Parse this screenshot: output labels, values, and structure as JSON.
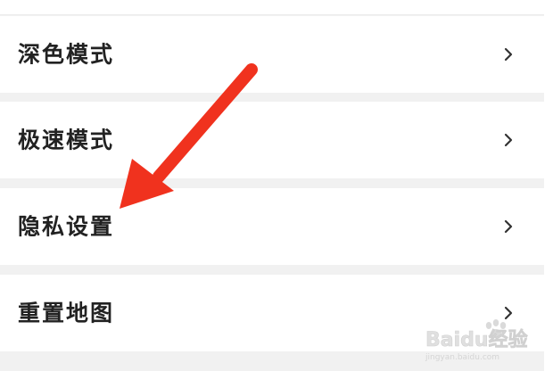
{
  "settings": {
    "items": [
      {
        "label": "深色模式",
        "icon": "chevron-right-icon"
      },
      {
        "label": "极速模式",
        "icon": "chevron-right-icon"
      },
      {
        "label": "隐私设置",
        "icon": "chevron-right-icon"
      },
      {
        "label": "重置地图",
        "icon": "chevron-right-icon"
      }
    ]
  },
  "annotation": {
    "arrow_color": "#f0321e"
  },
  "watermark": {
    "brand": "Baidu经验",
    "url": "jingyan.baidu.com"
  },
  "colors": {
    "background": "#f1f1f1",
    "row": "#ffffff",
    "text": "#222222",
    "chevron": "#333333"
  }
}
